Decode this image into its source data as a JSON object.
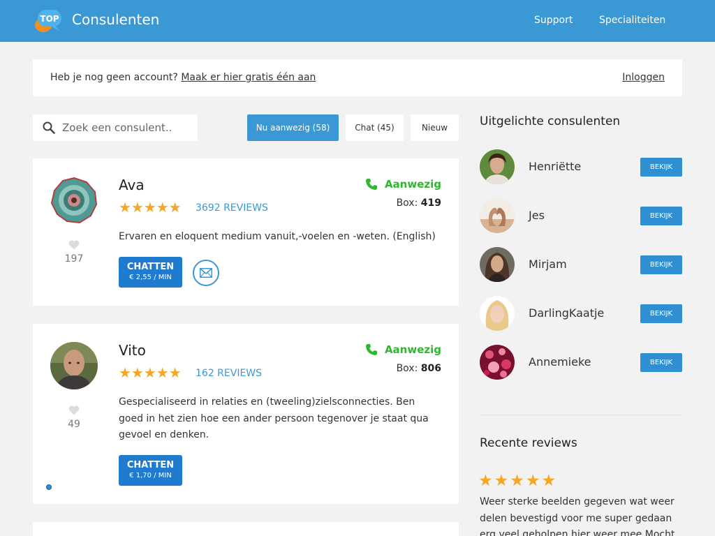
{
  "header": {
    "brand": "Consulenten",
    "logo_text": "TOP",
    "nav": [
      "Support",
      "Specialiteiten"
    ]
  },
  "account": {
    "prompt": "Heb je nog geen account?",
    "signup_link": "Maak er hier gratis één aan",
    "login": "Inloggen"
  },
  "search": {
    "placeholder": "Zoek een consulent.."
  },
  "filters": [
    {
      "label": "Nu aanwezig (58)",
      "active": true
    },
    {
      "label": "Chat (45)",
      "active": false
    },
    {
      "label": "Nieuw",
      "active": false
    }
  ],
  "consultants": [
    {
      "name": "Ava",
      "stars": "★★★★★",
      "reviews": "3692 REVIEWS",
      "status": "Aanwezig",
      "box_label": "Box:",
      "box_number": "419",
      "likes": "197",
      "description": "Ervaren en eloquent medium vanuit,-voelen en -weten. (English)",
      "chat_label": "CHATTEN",
      "chat_price": "€ 2,55 / MIN"
    },
    {
      "name": "Vito",
      "stars": "★★★★★",
      "reviews": "162 REVIEWS",
      "status": "Aanwezig",
      "box_label": "Box:",
      "box_number": "806",
      "likes": "49",
      "description": "Gespecialiseerd in relaties en (tweeling)zielsconnecties. Ben goed in het zien hoe een ander persoon tegenover je staat qua gevoel en denken.",
      "chat_label": "CHATTEN",
      "chat_price": "€ 1,70 / MIN"
    }
  ],
  "featured": {
    "title": "Uitgelichte consulenten",
    "button_label": "BEKIJK",
    "items": [
      {
        "name": "Henriëtte"
      },
      {
        "name": "Jes"
      },
      {
        "name": "Mirjam"
      },
      {
        "name": "DarlingKaatje"
      },
      {
        "name": "Annemieke"
      }
    ]
  },
  "recent_reviews": {
    "title": "Recente reviews",
    "stars": "★★★★★",
    "text": "Weer sterke beelden gegeven wat weer delen bevestigd voor me super gedaan erg veel geholpen hier weer mee Mocht je deze"
  },
  "colors": {
    "brand_blue": "#3a98d5",
    "chat_button": "#1e7bd0",
    "online_green": "#2eb82e",
    "star_gold": "#f5a623"
  }
}
